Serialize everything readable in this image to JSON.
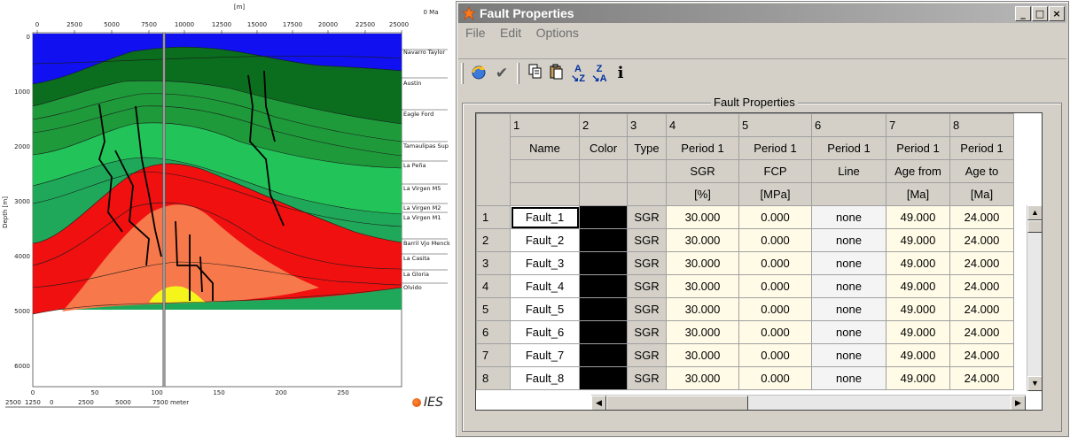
{
  "section": {
    "top_axis_unit": "[m]",
    "age_label": "0 Ma",
    "x_ticks": [
      "0",
      "2500",
      "5000",
      "7500",
      "10000",
      "12500",
      "15000",
      "17500",
      "20000",
      "22500",
      "25000"
    ],
    "y_ticks": [
      "0",
      "1000",
      "2000",
      "3000",
      "4000",
      "5000",
      "6000"
    ],
    "y_label": "Depth [m]",
    "bottom_ticks": [
      "0",
      "50",
      "100",
      "150",
      "200",
      "250"
    ],
    "scale_bar": [
      "2500",
      "1250",
      "0",
      "2500",
      "5000",
      "7500 meter"
    ],
    "layers": [
      "Navarro Taylor",
      "Austin",
      "Eagle Ford",
      "Tamaulipas Sup",
      "La Peña",
      "La Virgen M5",
      "La Virgen M2",
      "La Virgen M1",
      "Barril Vjo Menck",
      "La Casita",
      "La Gloria",
      "Olvido"
    ],
    "logo": "IES",
    "colors": {
      "navarro": "#1010f0",
      "dark_green": "#0a6e1e",
      "mid_green": "#1e9a3a",
      "light_green": "#22c45a",
      "red": "#f01010",
      "orange": "#f7784a",
      "yellow": "#f5f51c"
    }
  },
  "window": {
    "title": "Fault Properties",
    "menu": [
      "File",
      "Edit",
      "Options"
    ],
    "toolbar_icons": [
      "refresh-icon",
      "check-icon",
      "copy-icon",
      "paste-icon",
      "sort-az-icon",
      "sort-za-icon",
      "info-icon"
    ],
    "group_label": "Fault Properties",
    "columns": [
      {
        "num": "1",
        "h1": "Name",
        "h2": "",
        "h3": ""
      },
      {
        "num": "2",
        "h1": "Color",
        "h2": "",
        "h3": ""
      },
      {
        "num": "3",
        "h1": "Type",
        "h2": "",
        "h3": ""
      },
      {
        "num": "4",
        "h1": "Period 1",
        "h2": "SGR",
        "h3": "[%]"
      },
      {
        "num": "5",
        "h1": "Period 1",
        "h2": "FCP",
        "h3": "[MPa]"
      },
      {
        "num": "6",
        "h1": "Period 1",
        "h2": "Line",
        "h3": ""
      },
      {
        "num": "7",
        "h1": "Period 1",
        "h2": "Age from",
        "h3": "[Ma]"
      },
      {
        "num": "8",
        "h1": "Period 1",
        "h2": "Age to",
        "h3": "[Ma]"
      }
    ],
    "rows": [
      {
        "n": "1",
        "name": "Fault_1",
        "type": "SGR",
        "sgr": "30.000",
        "fcp": "0.000",
        "line": "none",
        "from": "49.000",
        "to": "24.000"
      },
      {
        "n": "2",
        "name": "Fault_2",
        "type": "SGR",
        "sgr": "30.000",
        "fcp": "0.000",
        "line": "none",
        "from": "49.000",
        "to": "24.000"
      },
      {
        "n": "3",
        "name": "Fault_3",
        "type": "SGR",
        "sgr": "30.000",
        "fcp": "0.000",
        "line": "none",
        "from": "49.000",
        "to": "24.000"
      },
      {
        "n": "4",
        "name": "Fault_4",
        "type": "SGR",
        "sgr": "30.000",
        "fcp": "0.000",
        "line": "none",
        "from": "49.000",
        "to": "24.000"
      },
      {
        "n": "5",
        "name": "Fault_5",
        "type": "SGR",
        "sgr": "30.000",
        "fcp": "0.000",
        "line": "none",
        "from": "49.000",
        "to": "24.000"
      },
      {
        "n": "6",
        "name": "Fault_6",
        "type": "SGR",
        "sgr": "30.000",
        "fcp": "0.000",
        "line": "none",
        "from": "49.000",
        "to": "24.000"
      },
      {
        "n": "7",
        "name": "Fault_7",
        "type": "SGR",
        "sgr": "30.000",
        "fcp": "0.000",
        "line": "none",
        "from": "49.000",
        "to": "24.000"
      },
      {
        "n": "8",
        "name": "Fault_8",
        "type": "SGR",
        "sgr": "30.000",
        "fcp": "0.000",
        "line": "none",
        "from": "49.000",
        "to": "24.000"
      }
    ]
  }
}
